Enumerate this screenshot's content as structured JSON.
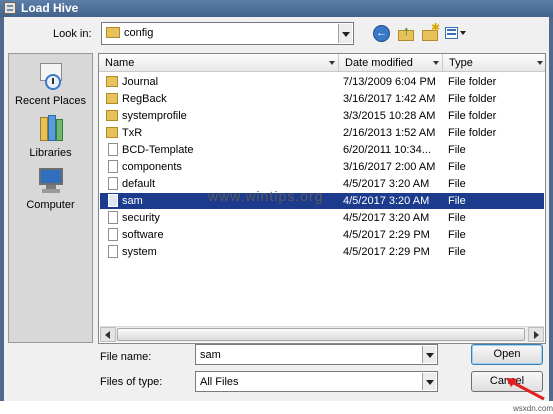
{
  "window": {
    "title": "Load Hive"
  },
  "lookin": {
    "label": "Look in:",
    "value": "config"
  },
  "toolbar": {
    "back_icon": "back-arrow-icon",
    "up_icon": "up-folder-icon",
    "new_icon": "new-folder-icon",
    "view_icon": "view-menu-icon"
  },
  "places": [
    {
      "label": "Recent Places",
      "icon": "recent-places-icon"
    },
    {
      "label": "Libraries",
      "icon": "libraries-icon"
    },
    {
      "label": "Computer",
      "icon": "computer-icon"
    }
  ],
  "columns": {
    "name": "Name",
    "date": "Date modified",
    "type": "Type"
  },
  "files": [
    {
      "name": "Journal",
      "date": "7/13/2009 6:04 PM",
      "type": "File folder",
      "kind": "folder"
    },
    {
      "name": "RegBack",
      "date": "3/16/2017 1:42 AM",
      "type": "File folder",
      "kind": "folder"
    },
    {
      "name": "systemprofile",
      "date": "3/3/2015 10:28 AM",
      "type": "File folder",
      "kind": "folder"
    },
    {
      "name": "TxR",
      "date": "2/16/2013 1:52 AM",
      "type": "File folder",
      "kind": "folder"
    },
    {
      "name": "BCD-Template",
      "date": "6/20/2011 10:34...",
      "type": "File",
      "kind": "file"
    },
    {
      "name": "components",
      "date": "3/16/2017 2:00 AM",
      "type": "File",
      "kind": "file"
    },
    {
      "name": "default",
      "date": "4/5/2017 3:20 AM",
      "type": "File",
      "kind": "file"
    },
    {
      "name": "sam",
      "date": "4/5/2017 3:20 AM",
      "type": "File",
      "kind": "file",
      "selected": true
    },
    {
      "name": "security",
      "date": "4/5/2017 3:20 AM",
      "type": "File",
      "kind": "file"
    },
    {
      "name": "software",
      "date": "4/5/2017 2:29 PM",
      "type": "File",
      "kind": "file"
    },
    {
      "name": "system",
      "date": "4/5/2017 2:29 PM",
      "type": "File",
      "kind": "file"
    }
  ],
  "watermark": "www.wintips.org",
  "filename": {
    "label": "File name:",
    "value": "sam"
  },
  "filetype": {
    "label": "Files of type:",
    "value": "All Files"
  },
  "buttons": {
    "open": "Open",
    "cancel": "Cancel"
  },
  "corner_watermark": "wsxdn.com",
  "colors": {
    "selection": "#1c3b8c",
    "titlebar": "#4f6a8c",
    "arrow": "#e02020"
  }
}
